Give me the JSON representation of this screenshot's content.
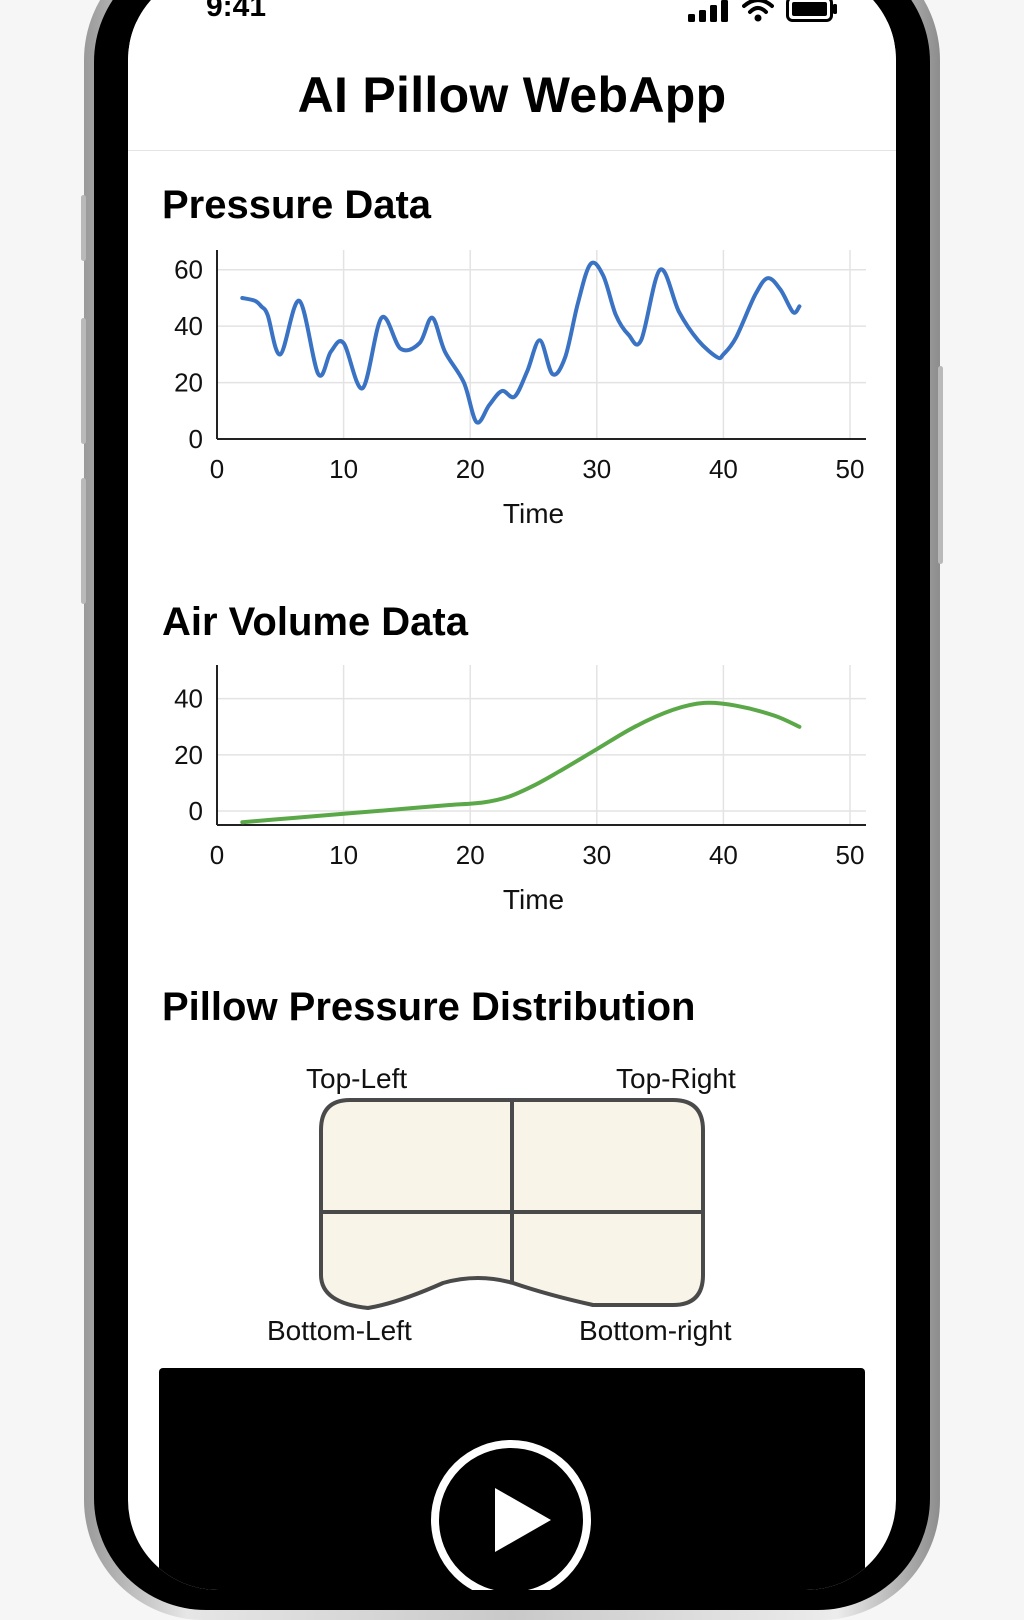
{
  "status_bar": {
    "time": "9:41",
    "icons": [
      "signal-icon",
      "wifi-icon",
      "battery-icon"
    ]
  },
  "header": {
    "title": "AI Pillow WebApp"
  },
  "pressure_section": {
    "title": "Pressure Data"
  },
  "air_volume_section": {
    "title": "Air Volume Data"
  },
  "pillow_section": {
    "title": "Pillow Pressure Distribution",
    "labels": {
      "top_left": "Top-Left",
      "top_right": "Top-Right",
      "bottom_left": "Bottom-Left",
      "bottom_right": "Bottom-right"
    }
  },
  "video": {
    "play_icon": "play-icon"
  },
  "colors": {
    "pressure_line": "#3a73c4",
    "air_volume_line": "#5aa848",
    "pillow_fill": "#f8f5e8",
    "pillow_stroke": "#4a4a4a"
  },
  "chart_data": [
    {
      "type": "line",
      "title": "Pressure Data",
      "xlabel": "Time",
      "ylabel": "",
      "xlim": [
        0,
        50
      ],
      "ylim": [
        0,
        67
      ],
      "x_ticks": [
        "0",
        "10",
        "20",
        "30",
        "40",
        "50"
      ],
      "y_ticks": [
        "0",
        "20",
        "40",
        "60"
      ],
      "grid": true,
      "series": [
        {
          "x": [
            2,
            3,
            3.5,
            4,
            5,
            6.5,
            8,
            9,
            10,
            11.5,
            13,
            14.5,
            16,
            17,
            18,
            19.5,
            20.5,
            21.5,
            22.5,
            23.5,
            24.5,
            25.5,
            26.5,
            27.5,
            28.5,
            29.5,
            30.5,
            31.5,
            32.5,
            33.5,
            35,
            36.5,
            38,
            39.5,
            40,
            41,
            42.5,
            43.5,
            44.5,
            45.5,
            46
          ],
          "y": [
            50,
            49,
            47,
            44,
            30,
            49,
            23,
            31,
            34,
            18,
            43,
            32,
            34,
            43,
            31,
            20,
            6,
            12,
            17,
            15,
            24,
            35,
            23,
            29,
            48,
            62,
            58,
            44,
            37,
            35,
            60,
            45,
            35,
            29,
            30,
            36,
            51,
            57,
            53,
            45,
            47
          ]
        }
      ]
    },
    {
      "type": "line",
      "title": "Air Volume Data",
      "xlabel": "Time",
      "ylabel": "",
      "xlim": [
        0,
        50
      ],
      "ylim": [
        -5,
        52
      ],
      "x_ticks": [
        "0",
        "10",
        "20",
        "30",
        "40",
        "50"
      ],
      "y_ticks": [
        "0",
        "20",
        "40"
      ],
      "grid": true,
      "series": [
        {
          "x": [
            2,
            6,
            10,
            14,
            18,
            21,
            23,
            25,
            27,
            30,
            33,
            36,
            38.5,
            41,
            44,
            46
          ],
          "y": [
            -4,
            -2.5,
            -1,
            0.5,
            2,
            3,
            5,
            9,
            14,
            22,
            30,
            36,
            38.5,
            37.5,
            34,
            30
          ]
        }
      ]
    }
  ]
}
